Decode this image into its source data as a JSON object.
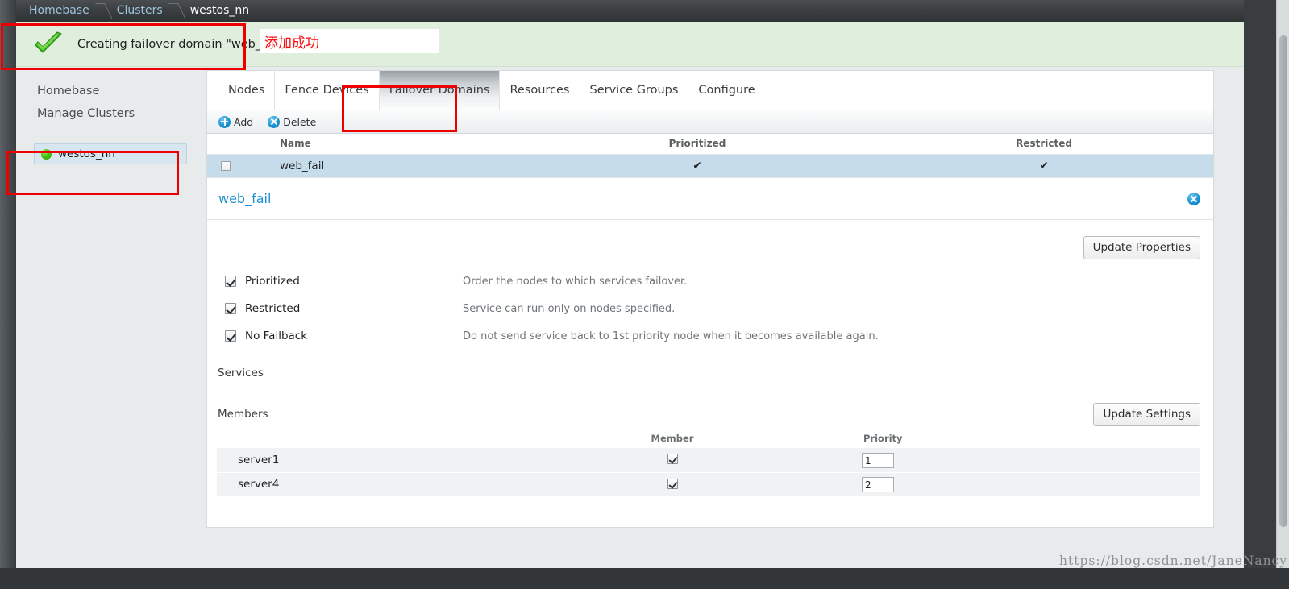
{
  "breadcrumb": {
    "items": [
      {
        "label": "Homebase",
        "current": false
      },
      {
        "label": "Clusters",
        "current": false
      },
      {
        "label": "westos_nn",
        "current": true
      }
    ]
  },
  "banner": {
    "icon": "green-check-icon",
    "message": "Creating failover domain \"web_fail\"",
    "background": "#dfeedd"
  },
  "annotation_note": {
    "text": "添加成功",
    "color": "#fb0b0b"
  },
  "sidebar": {
    "links": [
      {
        "label": "Homebase"
      },
      {
        "label": "Manage Clusters"
      }
    ],
    "clusters": [
      {
        "label": "westos_nn",
        "status": "online",
        "status_color": "#46c412",
        "selected": true
      }
    ]
  },
  "tabs": [
    {
      "label": "Nodes",
      "active": false
    },
    {
      "label": "Fence Devices",
      "active": false
    },
    {
      "label": "Failover Domains",
      "active": true
    },
    {
      "label": "Resources",
      "active": false
    },
    {
      "label": "Service Groups",
      "active": false
    },
    {
      "label": "Configure",
      "active": false
    }
  ],
  "toolbar": {
    "add_label": "Add",
    "delete_label": "Delete"
  },
  "domains_table": {
    "columns": [
      "Name",
      "Prioritized",
      "Restricted"
    ],
    "rows": [
      {
        "checked": false,
        "name": "web_fail",
        "prioritized": "✔",
        "restricted": "✔"
      }
    ]
  },
  "detail": {
    "title": "web_fail",
    "close_icon": "close-icon",
    "update_properties_label": "Update Properties",
    "update_settings_label": "Update Settings",
    "options": [
      {
        "label": "Prioritized",
        "checked": true,
        "description": "Order the nodes to which services failover."
      },
      {
        "label": "Restricted",
        "checked": true,
        "description": "Service can run only on nodes specified."
      },
      {
        "label": "No Failback",
        "checked": true,
        "description": "Do not send service back to 1st priority node when it becomes available again."
      }
    ],
    "services_label": "Services",
    "members_label": "Members",
    "members_table": {
      "columns": [
        "",
        "Member",
        "Priority"
      ],
      "rows": [
        {
          "name": "server1",
          "member_checked": true,
          "priority": "1"
        },
        {
          "name": "server4",
          "member_checked": true,
          "priority": "2"
        }
      ]
    }
  },
  "watermark": {
    "text": "https://blog.csdn.net/JaneNancy"
  },
  "annotations": {
    "accent_red": "#ef0000",
    "link_blue": "#1d8fd2",
    "selected_row_blue": "#c7dcea"
  }
}
